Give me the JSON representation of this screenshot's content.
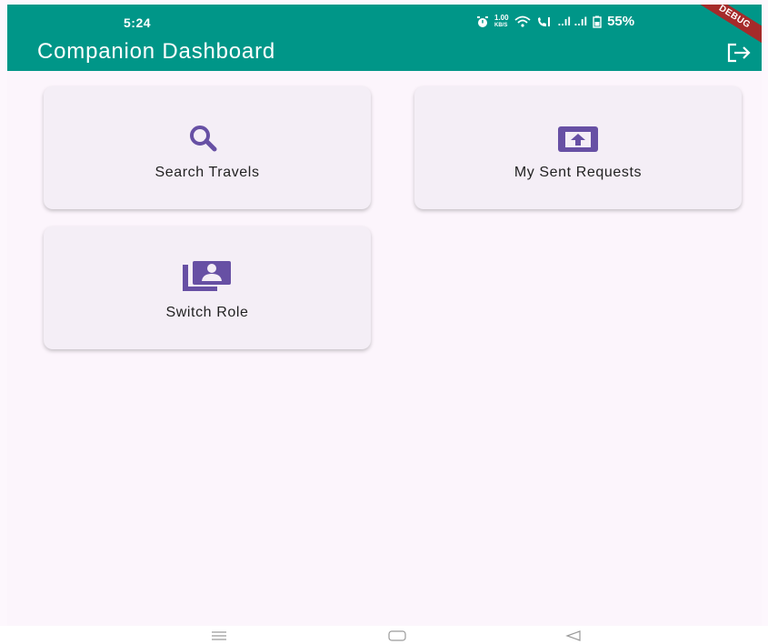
{
  "status_bar": {
    "time": "5:24",
    "speed_top": "1.00",
    "speed_unit": "KB/S",
    "signal": "..ıl ..ıl",
    "battery": "55%",
    "debug_banner": "DEBUG"
  },
  "appbar": {
    "title": "Companion Dashboard",
    "logout_icon": "logout-icon"
  },
  "cards": [
    {
      "label": "Search Travels",
      "icon": "search-icon"
    },
    {
      "label": "My Sent Requests",
      "icon": "outbox-icon"
    },
    {
      "label": "Switch Role",
      "icon": "switch-account-icon"
    }
  ],
  "colors": {
    "appbar": "#009688",
    "accent": "#6750a4",
    "background": "#fcf5fc",
    "card": "#f4eef6"
  },
  "nav_bar": {
    "buttons": [
      "menu-icon",
      "home-icon",
      "back-icon"
    ]
  }
}
